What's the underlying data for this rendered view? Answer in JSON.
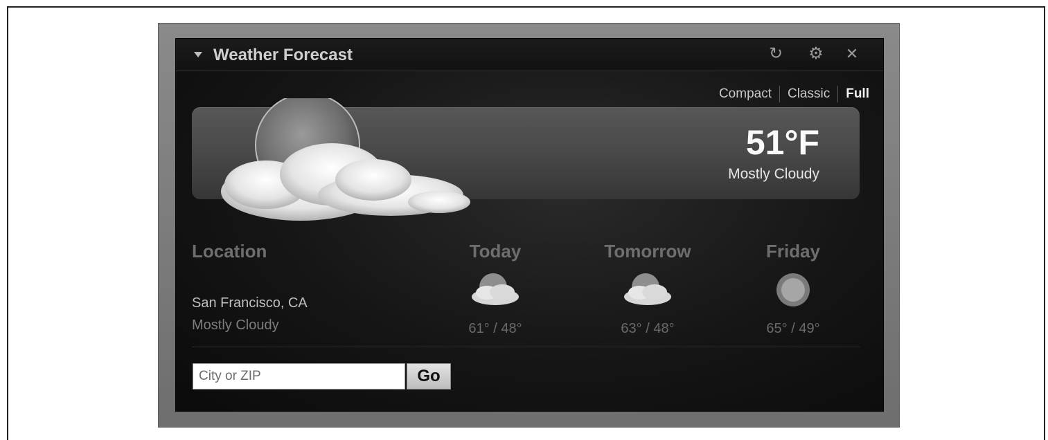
{
  "widget": {
    "title": "Weather Forecast",
    "icons": [
      "collapse-icon",
      "refresh-icon",
      "gear-icon",
      "close-icon"
    ]
  },
  "view_switch": {
    "options": [
      "Compact",
      "Classic",
      "Full"
    ],
    "active": "Full"
  },
  "current": {
    "temperature": "51°F",
    "condition": "Mostly Cloudy",
    "icon": "partly-cloudy-icon"
  },
  "location": {
    "heading": "Location",
    "city": "San Francisco, CA",
    "condition": "Mostly Cloudy"
  },
  "forecast": [
    {
      "day": "Today",
      "range": "61° / 48°",
      "icon": "partly-cloudy-icon"
    },
    {
      "day": "Tomorrow",
      "range": "63° / 48°",
      "icon": "partly-cloudy-icon"
    },
    {
      "day": "Friday",
      "range": "65° / 49°",
      "icon": "sun-icon"
    }
  ],
  "search": {
    "placeholder": "City or ZIP",
    "value": "",
    "button_label": "Go"
  }
}
